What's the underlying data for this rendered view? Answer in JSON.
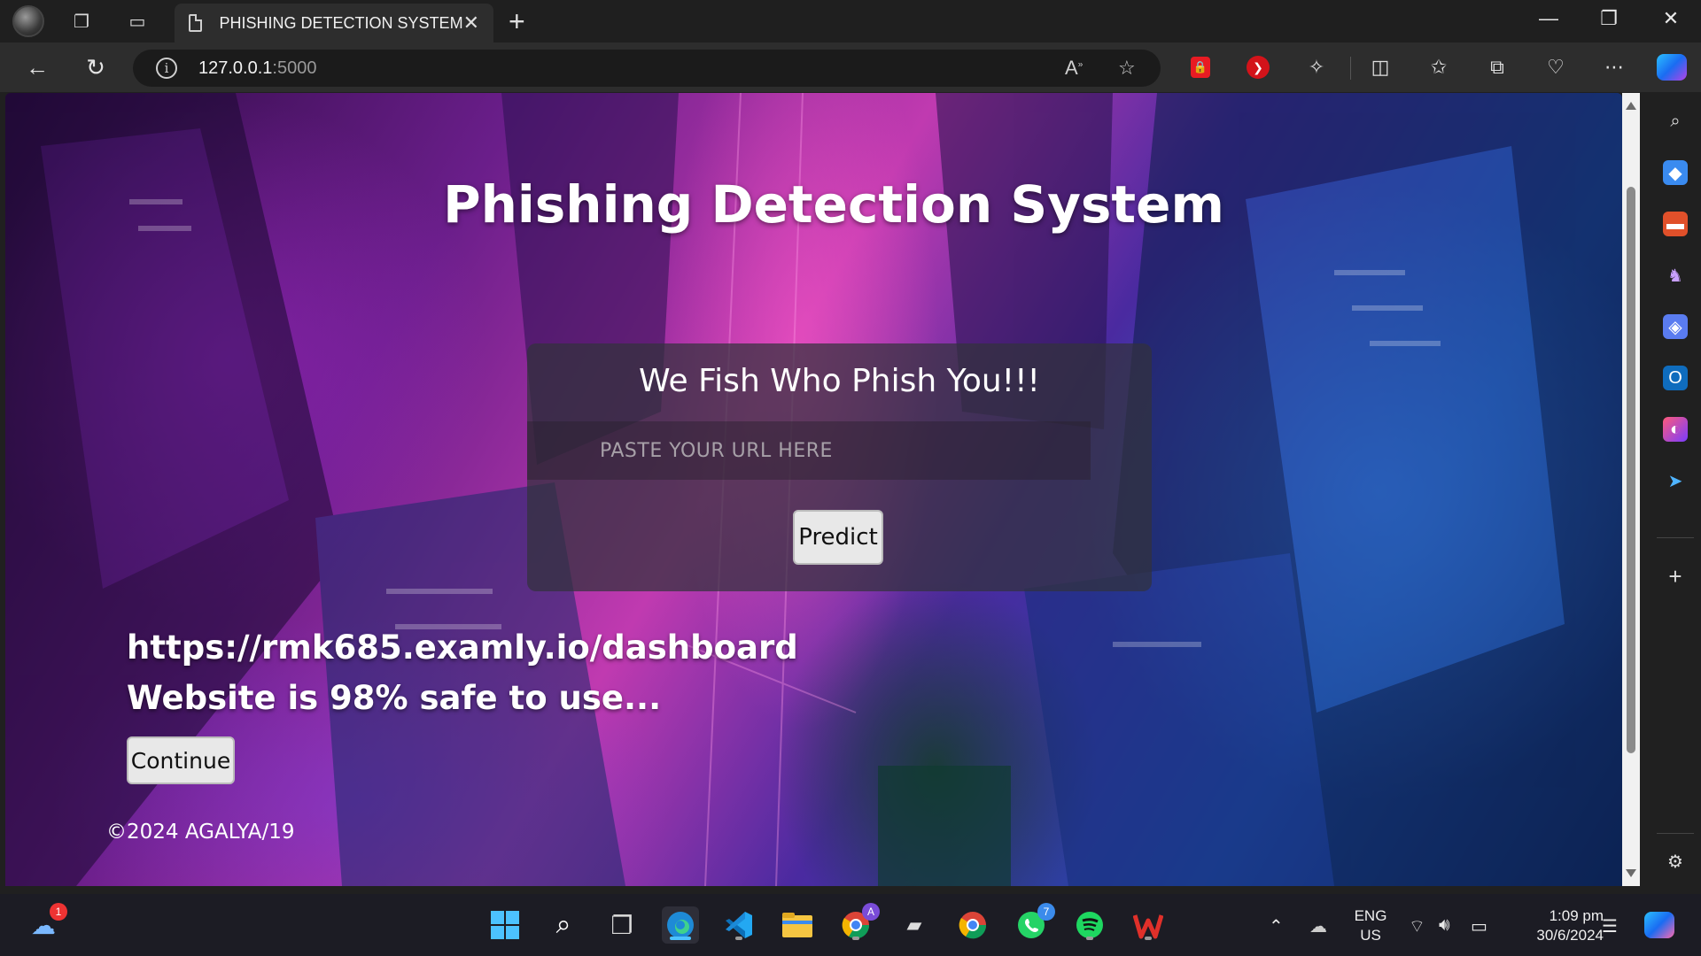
{
  "browser": {
    "tab_title": "PHISHING DETECTION SYSTEM",
    "url_host": "127.0.0.1",
    "url_port": ":5000"
  },
  "page": {
    "title": "Phishing Detection System",
    "card": {
      "heading": "We Fish Who Phish You!!!",
      "input_placeholder": "PASTE YOUR URL HERE",
      "input_value": "",
      "predict_label": "Predict"
    },
    "result": {
      "url": "https://rmk685.examly.io/dashboard",
      "message": "Website is 98% safe to use...",
      "continue_label": "Continue"
    },
    "footer": "©2024 AGALYA/19"
  },
  "taskbar": {
    "notification_badge": "1",
    "chrome_badge": "A",
    "whatsapp_badge": "7",
    "lang_line1": "ENG",
    "lang_line2": "US",
    "time": "1:09 pm",
    "date": "30/6/2024"
  },
  "colors": {
    "accent": "#4cc2ff",
    "title_bar": "#1f1f1f",
    "address_bar": "#2d2d2d",
    "taskbar": "#1c1c24"
  }
}
